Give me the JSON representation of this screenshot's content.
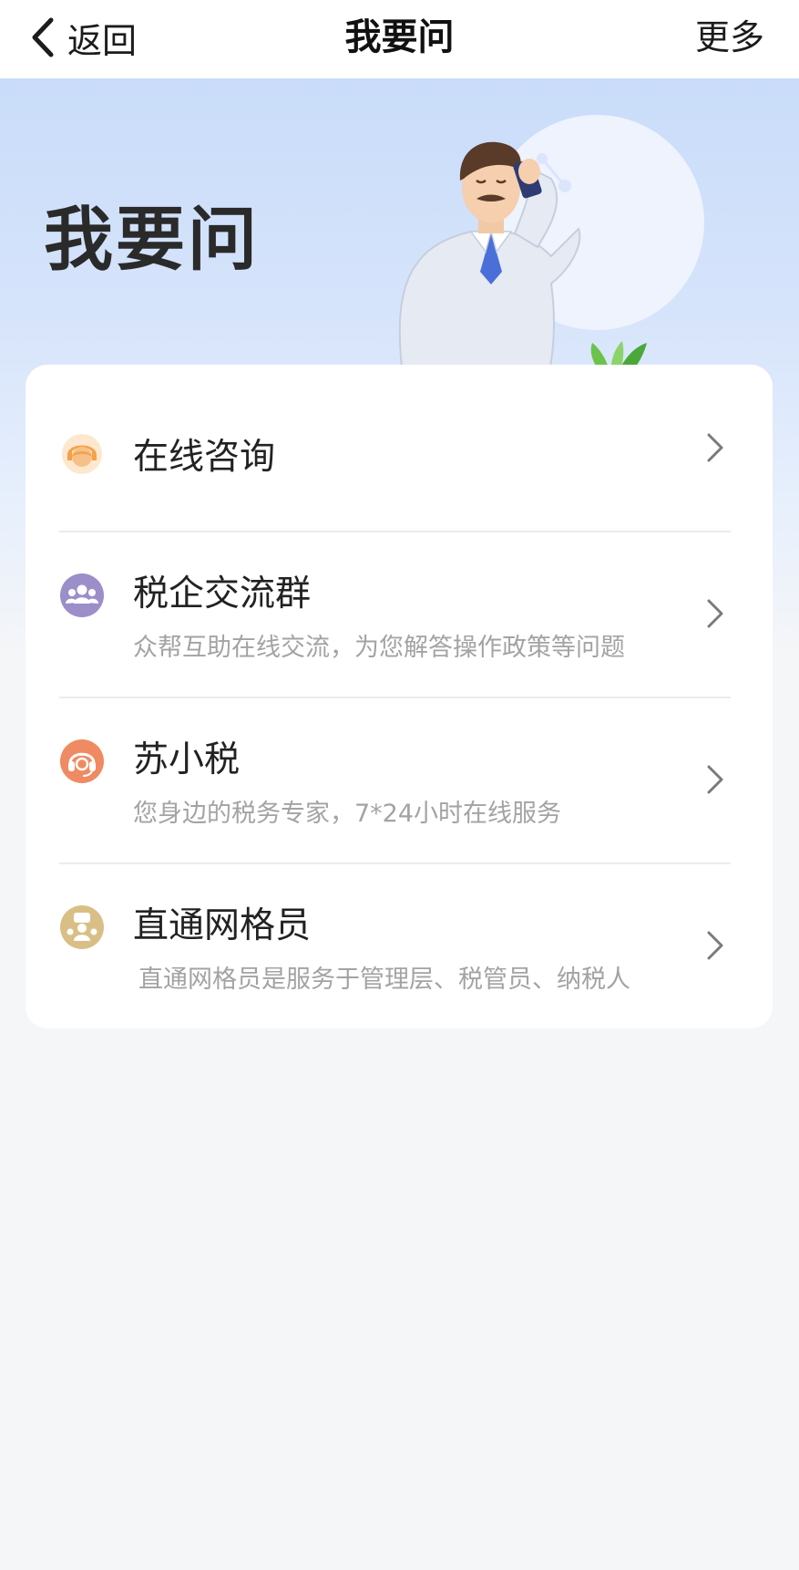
{
  "nav": {
    "back_label": "返回",
    "title": "我要问",
    "more_label": "更多"
  },
  "hero": {
    "title": "我要问"
  },
  "items": [
    {
      "title": "在线咨询",
      "subtitle": "",
      "icon": "customer-service-icon",
      "color": "#f3a24a"
    },
    {
      "title": "税企交流群",
      "subtitle": "众帮互助在线交流，为您解答操作政策等问题",
      "icon": "group-chat-icon",
      "color": "#9b8ec9"
    },
    {
      "title": "苏小税",
      "subtitle": "您身边的税务专家，7*24小时在线服务",
      "icon": "headset-icon",
      "color": "#ef8a62"
    },
    {
      "title": "直通网格员",
      "subtitle": "直通网格员是服务于管理层、税管员、纳税人",
      "icon": "grid-staff-icon",
      "color": "#d9bf86"
    }
  ],
  "colors": {
    "hero_top": "#c9dcf9",
    "page_background": "#f5f6f8"
  }
}
